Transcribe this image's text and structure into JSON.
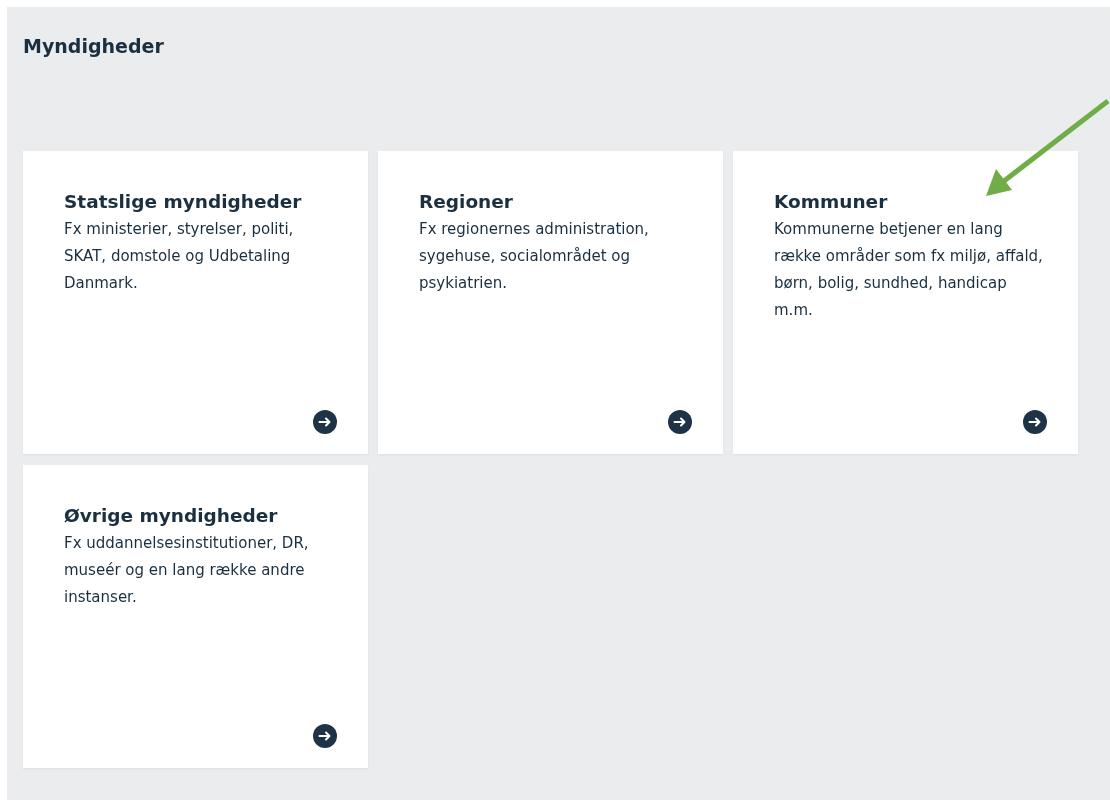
{
  "heading": "Myndigheder",
  "cards": [
    {
      "title": "Statslige myndigheder",
      "description": "Fx ministerier, styrelser, politi, SKAT, domstole og Udbetaling Danmark."
    },
    {
      "title": "Regioner",
      "description": "Fx regionernes administration, sygehuse, socialområdet og psykiatrien."
    },
    {
      "title": "Kommuner",
      "description": "Kommunerne betjener en lang række områder som fx miljø, affald, børn, bolig, sundhed, handicap m.m."
    },
    {
      "title": "Øvrige myndigheder",
      "description": "Fx uddannelsesinstitutioner, DR, museér og en lang række andre instanser."
    }
  ]
}
